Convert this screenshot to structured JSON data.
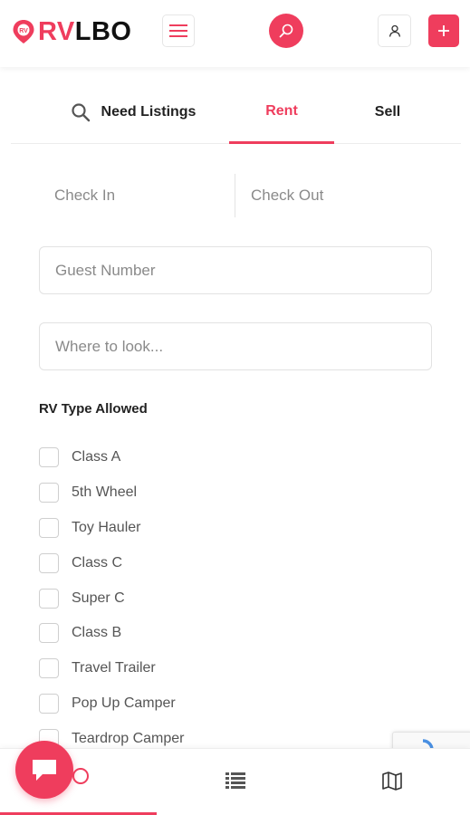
{
  "brand": {
    "name_part1": "RV",
    "name_part2": "LBO",
    "accent_color": "#ef3d5d",
    "logo_icon": "map-pin-icon"
  },
  "header": {
    "menu_icon": "hamburger-menu-icon",
    "search_icon": "search-icon",
    "user_icon": "user-icon",
    "add_icon": "plus-icon"
  },
  "tabs": [
    {
      "label": "Need Listings",
      "icon": "search-icon",
      "active": false
    },
    {
      "label": "Rent",
      "active": true
    },
    {
      "label": "Sell",
      "active": false
    }
  ],
  "dates": {
    "check_in": "Check In",
    "check_out": "Check Out"
  },
  "inputs": {
    "guest_placeholder": "Guest Number",
    "where_placeholder": "Where to look..."
  },
  "rv_types": {
    "title": "RV Type Allowed",
    "items": [
      {
        "label": "Class A",
        "checked": false
      },
      {
        "label": "5th Wheel",
        "checked": false
      },
      {
        "label": "Toy Hauler",
        "checked": false
      },
      {
        "label": "Class C",
        "checked": false
      },
      {
        "label": "Super C",
        "checked": false
      },
      {
        "label": "Class B",
        "checked": false
      },
      {
        "label": "Travel Trailer",
        "checked": false
      },
      {
        "label": "Pop Up Camper",
        "checked": false
      },
      {
        "label": "Teardrop Camper",
        "checked": false
      }
    ]
  },
  "bottom_nav": {
    "items": [
      {
        "icon": "home-icon",
        "active": true
      },
      {
        "icon": "list-icon",
        "active": false
      },
      {
        "icon": "map-icon",
        "active": false
      }
    ],
    "chat_icon": "chat-icon"
  }
}
